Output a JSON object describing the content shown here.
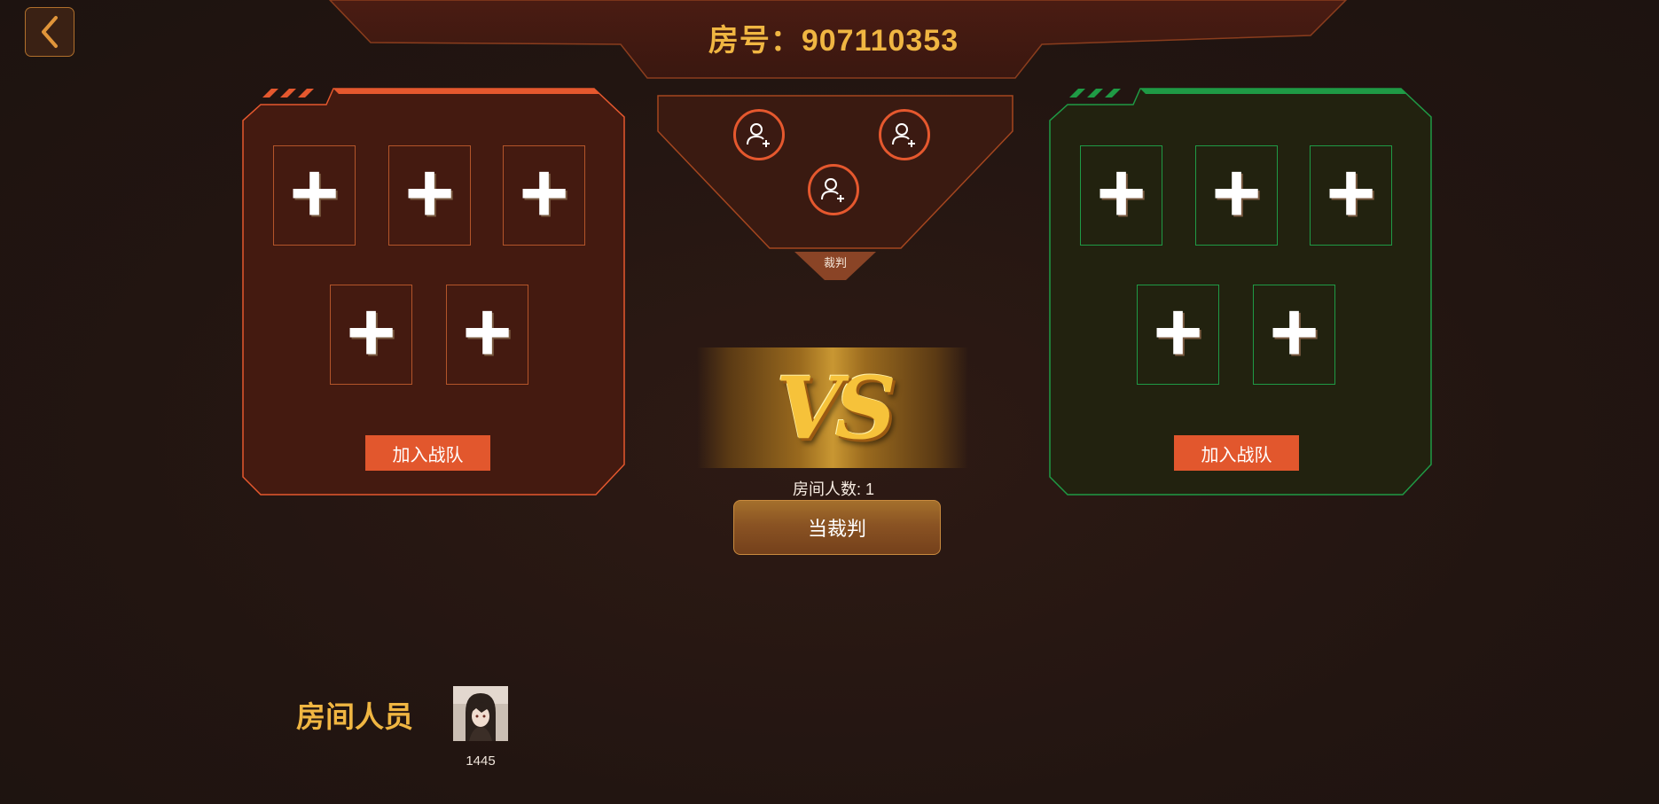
{
  "header": {
    "room_label": "房号：907110353"
  },
  "nav": {
    "back_icon": "chevron-left-icon"
  },
  "colors": {
    "accent": "#f0b642",
    "team_red": "#e2572d",
    "team_green": "#1f9a45",
    "panel_red": "#431a10",
    "panel_green": "#20210f"
  },
  "teams": [
    {
      "id": "red",
      "join_label": "加入战队",
      "slot_icon": "plus-icon"
    },
    {
      "id": "green",
      "join_label": "加入战队",
      "slot_icon": "plus-icon"
    }
  ],
  "referee": {
    "label": "裁判",
    "avatar_icon": "add-user-icon"
  },
  "vs": {
    "text": "VS"
  },
  "room": {
    "count_label": "房间人数: 1",
    "referee_button": "当裁判"
  },
  "members": {
    "title": "房间人员",
    "list": [
      {
        "name": "1445"
      }
    ]
  }
}
